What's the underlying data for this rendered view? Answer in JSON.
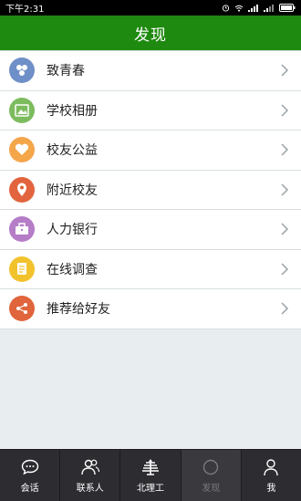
{
  "status_bar": {
    "time": "下午2:31"
  },
  "header": {
    "title": "发现"
  },
  "menu": [
    {
      "label": "致青春",
      "icon": "youth-icon",
      "color": "#6f8fc8"
    },
    {
      "label": "学校相册",
      "icon": "photo-album-icon",
      "color": "#7cbc5e"
    },
    {
      "label": "校友公益",
      "icon": "heart-icon",
      "color": "#f4a64a"
    },
    {
      "label": "附近校友",
      "icon": "location-pin-icon",
      "color": "#e2643e"
    },
    {
      "label": "人力银行",
      "icon": "briefcase-icon",
      "color": "#b57cc8"
    },
    {
      "label": "在线调查",
      "icon": "survey-icon",
      "color": "#f2c22c"
    },
    {
      "label": "推荐给好友",
      "icon": "share-icon",
      "color": "#e0653c"
    }
  ],
  "bottom_nav": [
    {
      "label": "会话",
      "icon": "chat-icon"
    },
    {
      "label": "联系人",
      "icon": "contacts-icon"
    },
    {
      "label": "北理工",
      "icon": "school-logo-icon"
    },
    {
      "label": "发现",
      "icon": "discover-icon",
      "active": true
    },
    {
      "label": "我",
      "icon": "profile-icon"
    }
  ],
  "colors": {
    "brand_green": "#1f8a10",
    "nav_bg": "#2d2c30"
  }
}
